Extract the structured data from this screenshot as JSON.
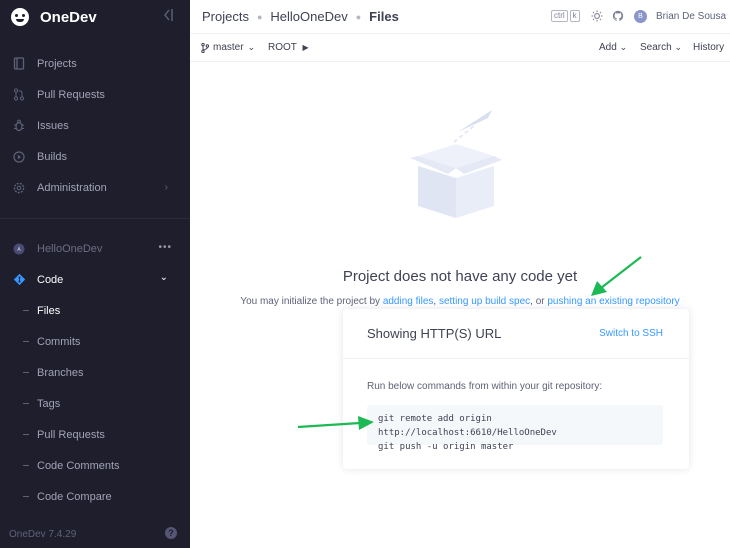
{
  "app": {
    "name": "OneDev",
    "version": "OneDev 7.4.29"
  },
  "sidebar": {
    "top_items": [
      {
        "label": "Projects",
        "icon": "projects-icon"
      },
      {
        "label": "Pull Requests",
        "icon": "pull-request-icon"
      },
      {
        "label": "Issues",
        "icon": "bug-icon"
      },
      {
        "label": "Builds",
        "icon": "play-icon"
      },
      {
        "label": "Administration",
        "icon": "gear-icon"
      }
    ],
    "project": {
      "name": "HelloOneDev",
      "more": "•••"
    },
    "code_label": "Code",
    "code_items": [
      "Files",
      "Commits",
      "Branches",
      "Tags",
      "Pull Requests",
      "Code Comments",
      "Code Compare"
    ],
    "help": "?"
  },
  "topbar": {
    "crumbs": [
      "Projects",
      "HelloOneDev",
      "Files"
    ],
    "kbd": [
      "ctrl",
      "k"
    ],
    "user_initial": "B",
    "user_name": "Brian De Sousa"
  },
  "subbar": {
    "branch": "master",
    "root": "ROOT",
    "add": "Add",
    "search": "Search",
    "history": "History"
  },
  "main": {
    "title": "Project does not have any code yet",
    "line_prefix": "You may initialize the project by ",
    "link_adding_files": "adding files",
    "sep1": ", ",
    "link_build_spec": "setting up build spec",
    "sep2": ", or ",
    "link_push": "pushing an existing repository"
  },
  "card": {
    "title": "Showing HTTP(S) URL",
    "switch": "Switch to SSH",
    "desc": "Run below commands from within your git repository:",
    "cmd1": "git remote add origin http://localhost:6610/HelloOneDev",
    "cmd2": "git push -u origin master"
  },
  "colors": {
    "sidebar_bg": "#1e1e2d",
    "link": "#3699ff",
    "arrow": "#1db954"
  }
}
